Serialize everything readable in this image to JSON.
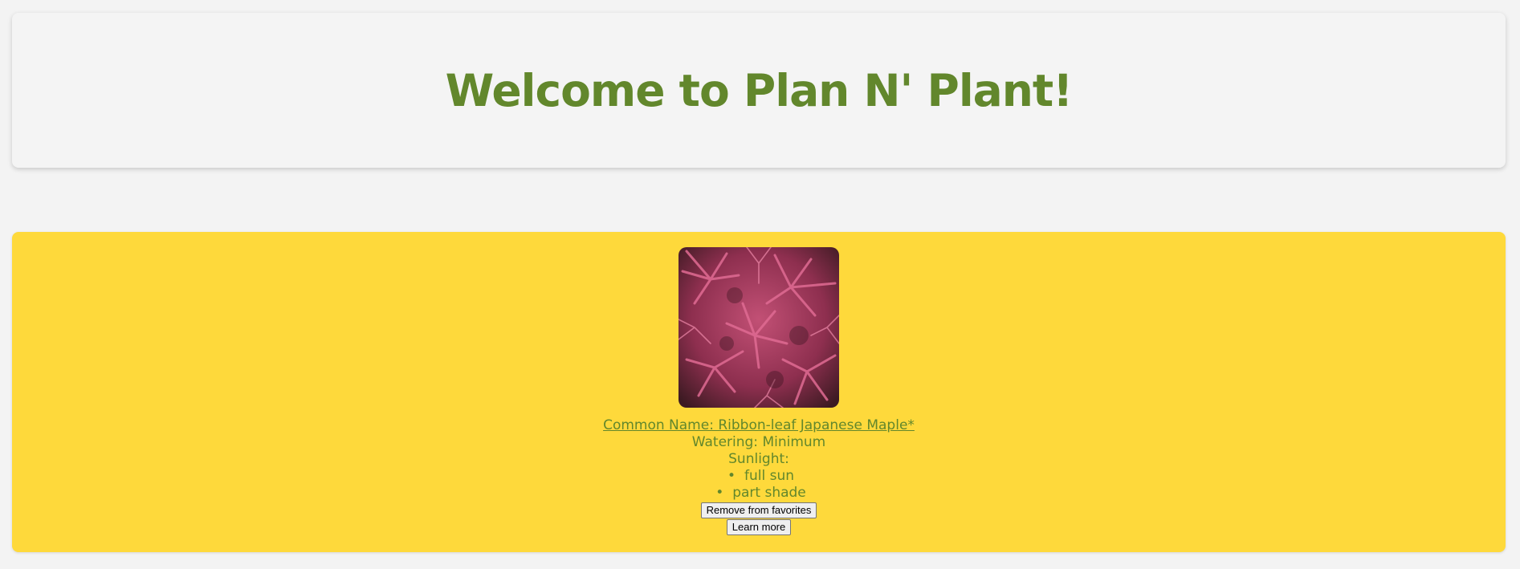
{
  "header": {
    "title": "Welcome to Plan N' Plant!"
  },
  "favorites": [
    {
      "image_subject": "Ribbon-leaf Japanese Maple foliage (pink-red leaves)",
      "common_name": "Common Name: Ribbon-leaf Japanese Maple*",
      "watering": "Watering: Minimum",
      "sunlight_label": "Sunlight:",
      "sunlight": [
        "full sun",
        "part shade"
      ],
      "remove_label": "Remove from favorites",
      "learn_more_label": "Learn more"
    }
  ],
  "colors": {
    "page_background": "#f3f3f3",
    "header_background": "#f4f4f4",
    "accent_green": "#62872c",
    "card_background": "#fed93b"
  }
}
